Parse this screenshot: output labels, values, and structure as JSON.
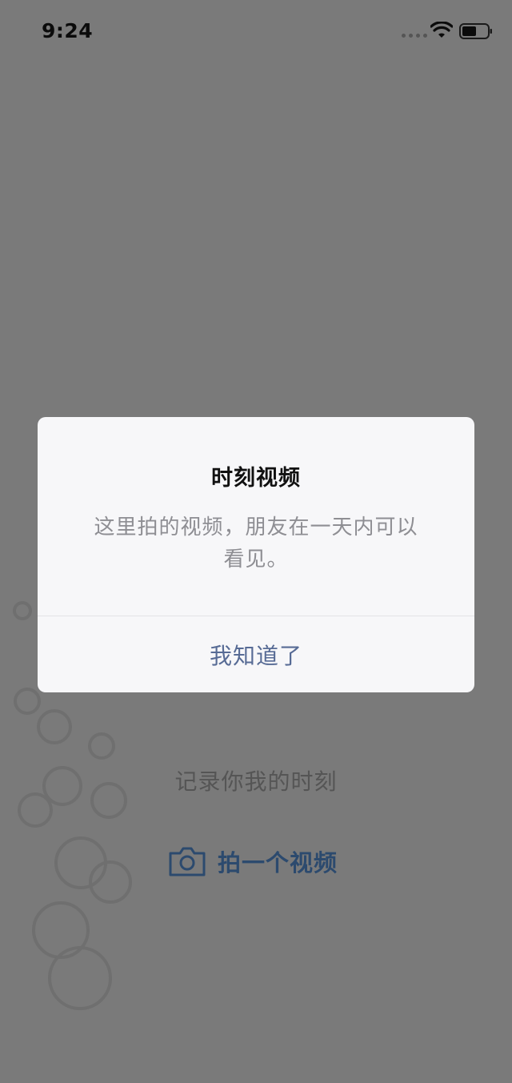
{
  "status_bar": {
    "time": "9:24",
    "signal_icon": "signal-dots-icon",
    "wifi_icon": "wifi-icon",
    "battery_icon": "battery-icon"
  },
  "background": {
    "caption": "记录你我的时刻",
    "record_label": "拍一个视频",
    "record_icon": "camera-icon",
    "accent_color": "#2c4a6e",
    "overlay_color": "#7a7a7a"
  },
  "dialog": {
    "title": "时刻视频",
    "message": "这里拍的视频，朋友在一天内可以看见。",
    "confirm_label": "我知道了",
    "confirm_color": "#576b95"
  }
}
